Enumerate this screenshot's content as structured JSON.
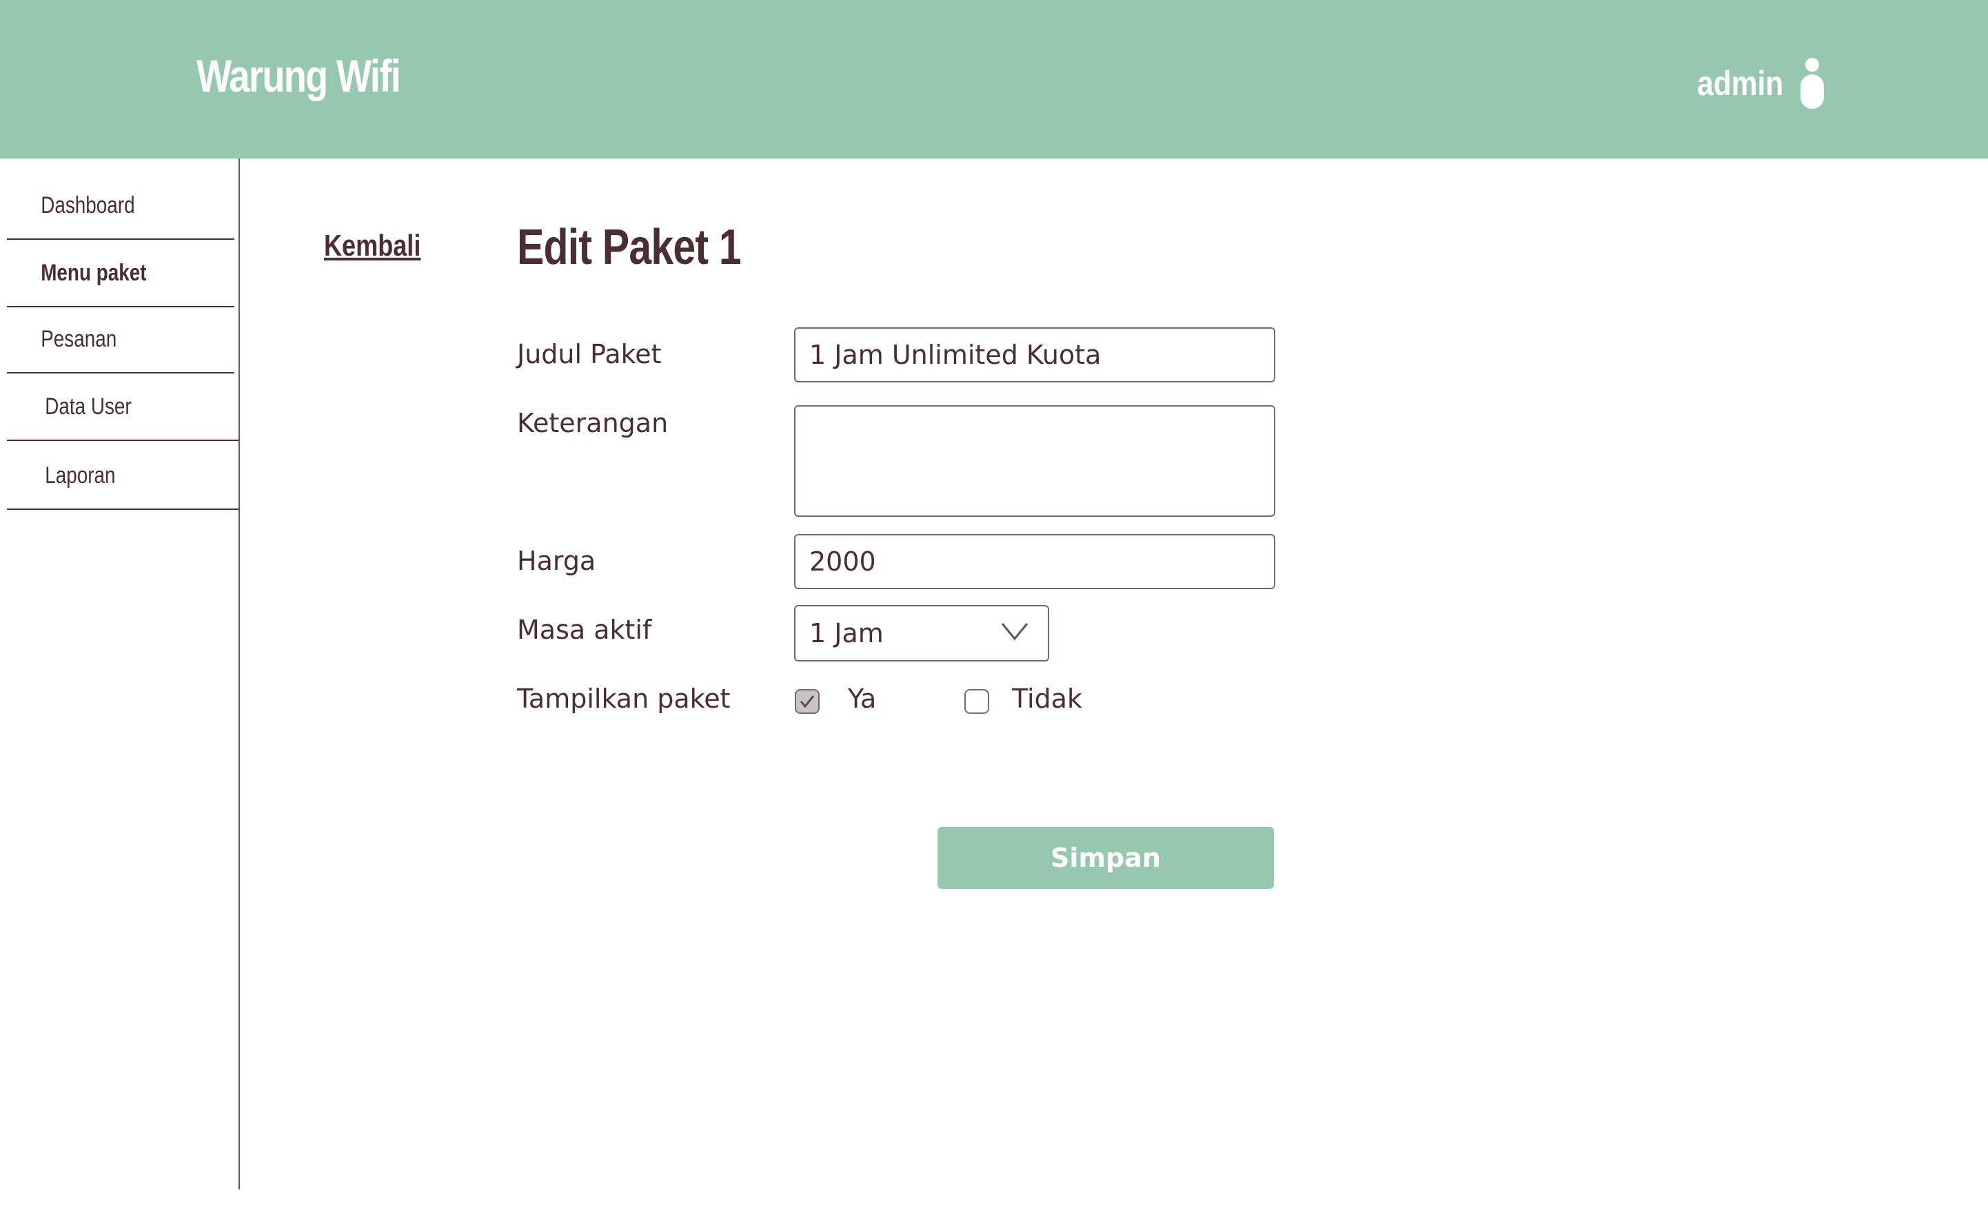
{
  "header": {
    "brand": "Warung Wifi",
    "user_name": "admin",
    "user_icon": "user-icon"
  },
  "sidebar": {
    "items": [
      {
        "label": "Dashboard",
        "active": false
      },
      {
        "label": "Menu paket",
        "active": true
      },
      {
        "label": "Pesanan",
        "active": false
      },
      {
        "label": "Data User",
        "active": false
      },
      {
        "label": "Laporan",
        "active": false
      }
    ]
  },
  "main": {
    "back_label": "Kembali",
    "title": "Edit Paket 1",
    "form": {
      "judul_label": "Judul Paket",
      "judul_value": "1 Jam Unlimited Kuota",
      "keterangan_label": "Keterangan",
      "keterangan_value": "",
      "harga_label": "Harga",
      "harga_value": "2000",
      "masa_label": "Masa aktif",
      "masa_value": "1 Jam",
      "tampilkan_label": "Tampilkan paket",
      "option_ya": "Ya",
      "option_ya_checked": true,
      "option_tidak": "Tidak",
      "option_tidak_checked": false,
      "save_label": "Simpan"
    }
  },
  "colors": {
    "accent": "#95c8ae",
    "text": "#4a2e31",
    "border": "#7d6668",
    "white": "#ffffff"
  }
}
